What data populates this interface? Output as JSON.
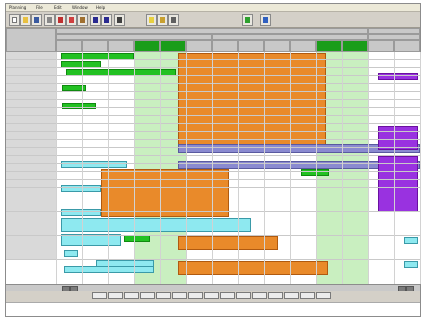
{
  "menubar": {
    "items": [
      "Planning",
      "File",
      "Edit",
      "Window",
      "Help"
    ]
  },
  "toolbar": {
    "icons": [
      "new-icon",
      "open-icon",
      "save-icon",
      "print-icon",
      "cut-icon",
      "copy-icon",
      "paste-icon",
      "undo-icon",
      "redo-icon",
      "zoom-icon",
      "filter-icon",
      "lock-icon",
      "find-icon",
      "calendar-icon",
      "help-icon"
    ]
  },
  "header": {
    "top_groups": [
      "",
      "",
      ""
    ],
    "weeks": [
      "",
      ""
    ]
  },
  "rows": [
    {
      "a": "",
      "b": "",
      "c": ""
    },
    {
      "a": "",
      "b": "",
      "c": ""
    },
    {
      "a": "",
      "b": "",
      "c": ""
    },
    {
      "a": "",
      "b": "",
      "c": ""
    },
    {
      "a": "",
      "b": "",
      "c": ""
    },
    {
      "a": "",
      "b": "",
      "c": ""
    },
    {
      "a": "",
      "b": "",
      "c": ""
    },
    {
      "a": "",
      "b": "",
      "c": ""
    },
    {
      "a": "",
      "b": "",
      "c": ""
    },
    {
      "a": "",
      "b": "",
      "c": ""
    },
    {
      "a": "",
      "b": "",
      "c": ""
    },
    {
      "a": "",
      "b": "",
      "c": ""
    },
    {
      "a": "",
      "b": "",
      "c": ""
    },
    {
      "a": "",
      "b": "",
      "c": ""
    },
    {
      "a": "",
      "b": "",
      "c": ""
    },
    {
      "a": "",
      "b": "",
      "c": ""
    },
    {
      "a": "",
      "b": "",
      "c": ""
    },
    {
      "a": "",
      "b": "",
      "c": ""
    },
    {
      "a": "",
      "b": "",
      "c": ""
    },
    {
      "a": "",
      "b": "",
      "c": ""
    }
  ],
  "bars": {
    "orange_main": "",
    "orange_mid": "",
    "orange_low": "",
    "purple_1": "",
    "purple_2": "",
    "cyan_1": "",
    "cyan_2": "",
    "green_top": ""
  },
  "navbar": {
    "label": ""
  },
  "tabs": [
    "",
    "",
    "",
    "",
    "",
    "",
    "",
    "",
    "",
    "",
    "",
    "",
    "",
    "",
    ""
  ],
  "colors": {
    "orange": "#e98a2a",
    "green": "#22c122",
    "cyan": "#8ee9f0",
    "purple": "#8a8ad0",
    "violet": "#9932e0",
    "header_green": "#1a9d1a"
  }
}
